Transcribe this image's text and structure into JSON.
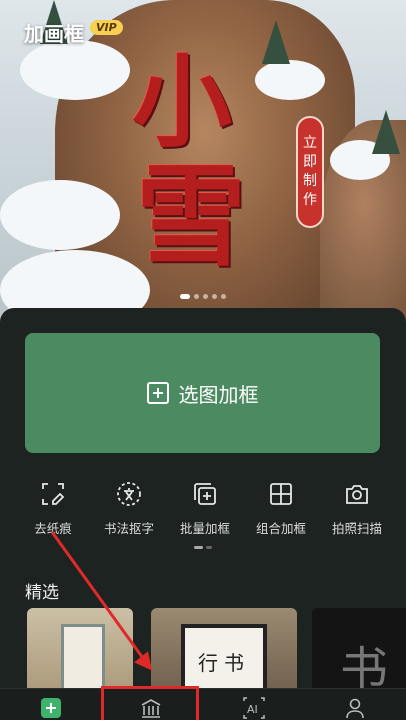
{
  "app": {
    "title": "加画框",
    "vip_badge": "VIP"
  },
  "banner": {
    "calligraphy_line1": "小",
    "calligraphy_line2": "雪",
    "make_now_button": "立即制作",
    "slide_count": 5,
    "active_slide": 0
  },
  "main_action": {
    "label": "选图加框"
  },
  "tools": [
    {
      "label": "去纸痕",
      "icon": "erase-frame-icon"
    },
    {
      "label": "书法抠字",
      "icon": "text-cutout-icon"
    },
    {
      "label": "批量加框",
      "icon": "batch-frame-icon"
    },
    {
      "label": "组合加框",
      "icon": "grid-frame-icon"
    },
    {
      "label": "拍照扫描",
      "icon": "camera-icon"
    }
  ],
  "featured": {
    "title": "精选",
    "items": [
      {
        "icon": "hanging-scroll-thumbnail"
      },
      {
        "icon": "framed-calligraphy-thumbnail",
        "text": "行书"
      },
      {
        "icon": "calligraphy-dark-thumbnail",
        "text": "书"
      }
    ]
  },
  "tabbar": [
    {
      "icon": "add-tab-icon",
      "active": true
    },
    {
      "icon": "museum-tab-icon"
    },
    {
      "icon": "ai-tab-icon",
      "text": "AI"
    },
    {
      "icon": "profile-tab-icon"
    }
  ],
  "colors": {
    "accent_green": "#4c8a62",
    "panel_bg": "#1d2320",
    "annotation_red": "#e02a2a",
    "calligraphy_red": "#b41e1e"
  }
}
